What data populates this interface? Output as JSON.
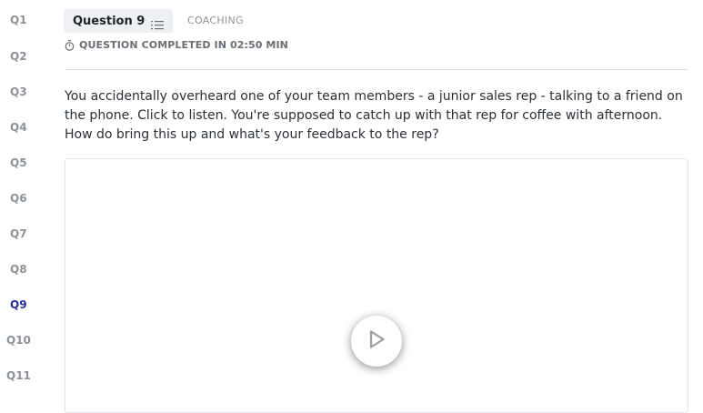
{
  "sidebar": {
    "items": [
      {
        "label": "Q1"
      },
      {
        "label": "Q2"
      },
      {
        "label": "Q3"
      },
      {
        "label": "Q4"
      },
      {
        "label": "Q5"
      },
      {
        "label": "Q6"
      },
      {
        "label": "Q7"
      },
      {
        "label": "Q8"
      },
      {
        "label": "Q9",
        "active": true
      },
      {
        "label": "Q10"
      },
      {
        "label": "Q11"
      }
    ],
    "active_color": "#2a2b9c",
    "inactive_color": "#8d9198"
  },
  "header": {
    "question_title": "Question 9",
    "question_icon": "list-icon",
    "category": "COACHING",
    "status_icon": "timer-icon",
    "status_text": "QUESTION COMPLETED IN 02:50 MIN"
  },
  "main": {
    "prompt": "You accidentally overheard one of your team members - a junior sales rep - talking to a friend on the phone. Click to listen. You're supposed to catch up with that rep for coffee with afternoon. How do bring this up and what's your feedback to the rep?",
    "media": {
      "play_icon": "play-icon"
    }
  }
}
